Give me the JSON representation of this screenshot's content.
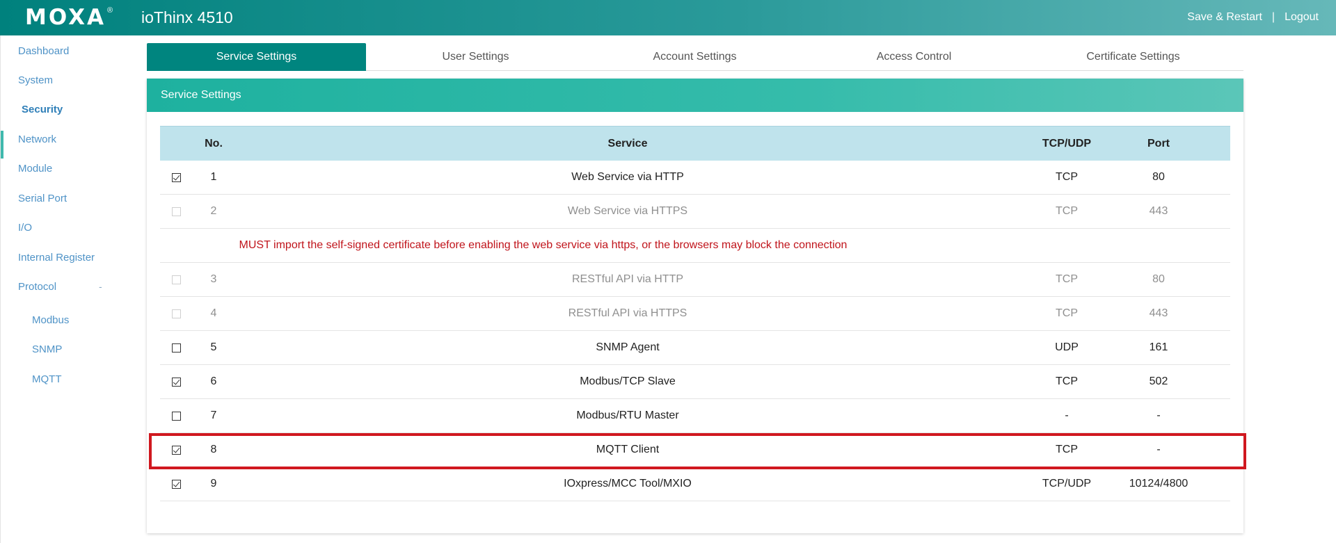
{
  "header": {
    "logo": "MOXA",
    "logo_mark": "®",
    "product": "ioThinx 4510",
    "save_restart": "Save & Restart",
    "separator": "|",
    "logout": "Logout"
  },
  "sidebar": {
    "items": [
      {
        "label": "Dashboard"
      },
      {
        "label": "System"
      },
      {
        "label": "Security"
      },
      {
        "label": "Network"
      },
      {
        "label": "Module"
      },
      {
        "label": "Serial Port"
      },
      {
        "label": "I/O"
      },
      {
        "label": "Internal Register"
      },
      {
        "label": "Protocol"
      }
    ],
    "protocol_toggle": "-",
    "sub_items": [
      {
        "label": "Modbus"
      },
      {
        "label": "SNMP"
      },
      {
        "label": "MQTT"
      }
    ]
  },
  "tabs": [
    {
      "label": "Service Settings"
    },
    {
      "label": "User Settings"
    },
    {
      "label": "Account Settings"
    },
    {
      "label": "Access Control"
    },
    {
      "label": "Certificate Settings"
    }
  ],
  "panel": {
    "title": "Service Settings",
    "columns": {
      "no": "No.",
      "service": "Service",
      "protocol": "TCP/UDP",
      "port": "Port"
    },
    "warning": "MUST import the self-signed certificate before enabling the web service via https, or the browsers may block the connection",
    "rows": [
      {
        "no": "1",
        "service": "Web Service via HTTP",
        "protocol": "TCP",
        "port": "80",
        "checked": true,
        "disabled": false
      },
      {
        "no": "2",
        "service": "Web Service via HTTPS",
        "protocol": "TCP",
        "port": "443",
        "checked": false,
        "disabled": true
      },
      {
        "no": "3",
        "service": "RESTful API via HTTP",
        "protocol": "TCP",
        "port": "80",
        "checked": false,
        "disabled": true
      },
      {
        "no": "4",
        "service": "RESTful API via HTTPS",
        "protocol": "TCP",
        "port": "443",
        "checked": false,
        "disabled": true
      },
      {
        "no": "5",
        "service": "SNMP Agent",
        "protocol": "UDP",
        "port": "161",
        "checked": false,
        "disabled": false
      },
      {
        "no": "6",
        "service": "Modbus/TCP Slave",
        "protocol": "TCP",
        "port": "502",
        "checked": true,
        "disabled": false
      },
      {
        "no": "7",
        "service": "Modbus/RTU Master",
        "protocol": "-",
        "port": "-",
        "checked": false,
        "disabled": false
      },
      {
        "no": "8",
        "service": "MQTT Client",
        "protocol": "TCP",
        "port": "-",
        "checked": true,
        "disabled": false
      },
      {
        "no": "9",
        "service": "IOxpress/MCC Tool/MXIO",
        "protocol": "TCP/UDP",
        "port": "10124/4800",
        "checked": true,
        "disabled": false
      }
    ]
  },
  "colors": {
    "brand_teal": "#00857f",
    "header_bg": "#bfe3ec",
    "warning_red": "#c0141b",
    "highlight_red": "#d0181f",
    "link_blue": "#4f93c7"
  }
}
